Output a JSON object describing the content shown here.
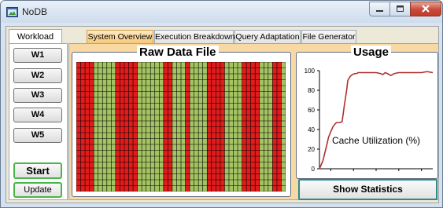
{
  "window": {
    "title": "NoDB",
    "icon": "app-icon",
    "controls": [
      "minimize-icon",
      "maximize-icon",
      "close-icon"
    ]
  },
  "left_panel": {
    "tab_label": "Workload",
    "workloads": [
      "W1",
      "W2",
      "W3",
      "W4",
      "W5"
    ],
    "start_label": "Start",
    "update_label": "Update"
  },
  "tabs": [
    {
      "label": "System Overview",
      "active": true
    },
    {
      "label": "Execution Breakdown",
      "active": false
    },
    {
      "label": "Query Adaptation",
      "active": false
    },
    {
      "label": "File Generator",
      "active": false
    }
  ],
  "raw_data": {
    "title": "Raw Data File",
    "rows": 22,
    "cols": 48,
    "red_columns": [
      0,
      1,
      2,
      3,
      9,
      10,
      11,
      12,
      13,
      20,
      21,
      25,
      30,
      31,
      32,
      33,
      38,
      39,
      40,
      41,
      45,
      46
    ],
    "colors": {
      "red": "#e21b1b",
      "green": "#a4c362",
      "gridline": "#000000"
    }
  },
  "usage": {
    "title": "Usage",
    "stats_button": "Show Statistics",
    "chart_data": {
      "type": "line",
      "annotation": "Cache Utilization (%)",
      "y_ticks": [
        "0",
        "20",
        "40",
        "60",
        "80",
        "100"
      ],
      "ylim": [
        0,
        100
      ],
      "x_ticks": [
        "",
        "",
        "",
        "",
        ""
      ],
      "xlim": [
        0,
        100
      ],
      "line_color": "#b03030",
      "series": [
        {
          "x": [
            0,
            3,
            6,
            8,
            10,
            12,
            14,
            15,
            17,
            18,
            20,
            22,
            24,
            25,
            27,
            29,
            31,
            33,
            34,
            36,
            40,
            45,
            50,
            54,
            56,
            58,
            60,
            63,
            66,
            70,
            75,
            80,
            85,
            90,
            95,
            100
          ],
          "y": [
            0,
            8,
            22,
            32,
            38,
            43,
            46,
            47,
            47,
            47,
            48,
            65,
            80,
            90,
            94,
            96,
            97,
            97,
            98,
            98,
            98,
            98,
            98,
            97,
            96,
            98,
            97,
            95,
            97,
            98,
            98,
            98,
            98,
            98,
            99,
            98
          ]
        }
      ]
    }
  }
}
